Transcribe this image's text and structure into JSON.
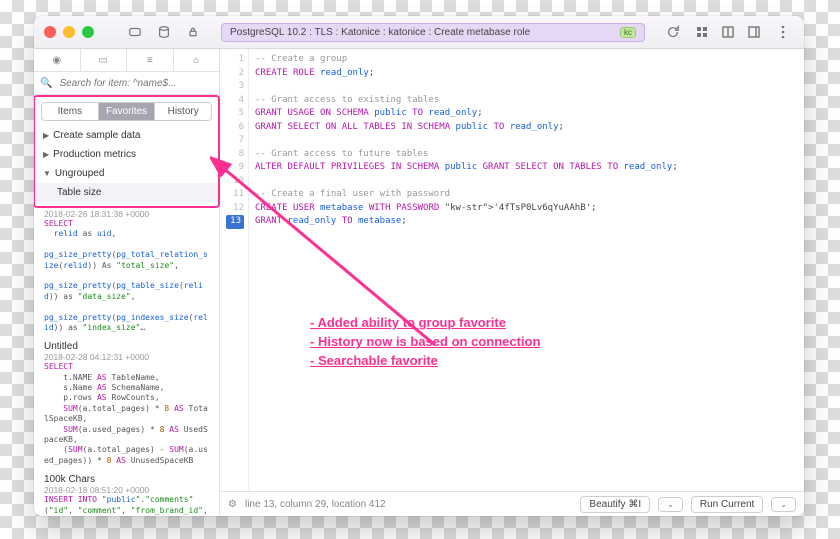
{
  "titlebar": {
    "path": "PostgreSQL 10.2 : TLS : Katonice : katonice : Create metabase role",
    "chip": "kc"
  },
  "sidebar": {
    "search_placeholder": "Search for item: ^name$...",
    "tabs": {
      "items": "Items",
      "favorites": "Favorites",
      "history": "History"
    },
    "groups": [
      {
        "label": "Create sample data",
        "expanded": false
      },
      {
        "label": "Production metrics",
        "expanded": false
      },
      {
        "label": "Ungrouped",
        "expanded": true,
        "children": [
          "Table size"
        ]
      }
    ],
    "snippets": [
      {
        "ts": "2018-02-26 18:31:38 +0000",
        "title": "",
        "pre": "SELECT\n  relid as uid,\n\npg_size_pretty(pg_total_relation_size(relid)) As \"total_size\",\n\npg_size_pretty(pg_table_size(relid)) as \"data_size\",\n\npg_size_pretty(pg_indexes_size(relid)) as \"index_size\"…"
      },
      {
        "ts": "2018-02-28 04:12:31 +0000",
        "title": "Untitled",
        "pre": "SELECT\n    t.NAME AS TableName,\n    s.Name AS SchemaName,\n    p.rows AS RowCounts,\n    SUM(a.total_pages) * 8 AS TotalSpaceKB,\n    SUM(a.used_pages) * 8 AS UsedSpaceKB,\n    (SUM(a.total_pages) - SUM(a.used_pages)) * 8 AS UnusedSpaceKB"
      },
      {
        "ts": "2018-02-18 08:51:20 +0000",
        "title": "100k Chars",
        "pre": "INSERT INTO \"public\".\"comments\" (\"id\", \"comment\", \"from_brand_id\", \"from_user_id\", \"to_user_id\", \"object_id\", \"created_at\","
      }
    ]
  },
  "editor": {
    "lines": [
      {
        "n": 1,
        "t": "-- Create a group",
        "k": "cm"
      },
      {
        "n": 2,
        "t": "CREATE ROLE read_only;"
      },
      {
        "n": 3,
        "t": ""
      },
      {
        "n": 4,
        "t": "-- Grant access to existing tables",
        "k": "cm"
      },
      {
        "n": 5,
        "t": "GRANT USAGE ON SCHEMA public TO read_only;"
      },
      {
        "n": 6,
        "t": "GRANT SELECT ON ALL TABLES IN SCHEMA public TO read_only;"
      },
      {
        "n": 7,
        "t": ""
      },
      {
        "n": 8,
        "t": "-- Grant access to future tables",
        "k": "cm"
      },
      {
        "n": 9,
        "t": "ALTER DEFAULT PRIVILEGES IN SCHEMA public GRANT SELECT ON TABLES TO read_only;"
      },
      {
        "n": 10,
        "t": ""
      },
      {
        "n": 11,
        "t": "-- Create a final user with password",
        "k": "cm"
      },
      {
        "n": 12,
        "t": "CREATE USER metabase WITH PASSWORD '4fTsP0Lv6qYuAAhB';"
      },
      {
        "n": 13,
        "t": "GRANT read_only TO metabase;",
        "cur": true
      }
    ],
    "status": "line 13, column 29, location 412",
    "beautify": "Beautify ⌘I",
    "run": "Run Current"
  },
  "annotations": [
    "- Added ability to group favorite",
    "- History now is based on connection",
    "- Searchable favorite"
  ]
}
